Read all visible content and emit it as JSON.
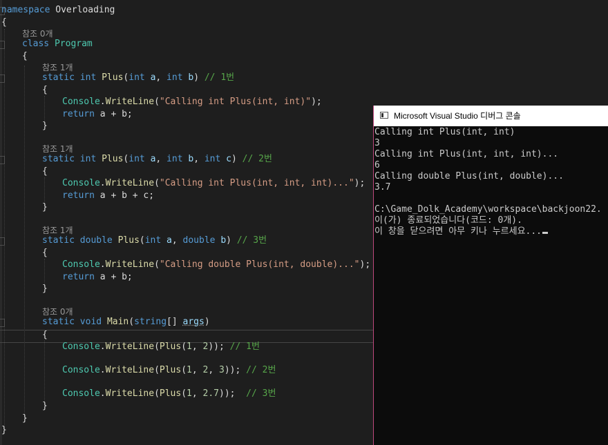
{
  "editor": {
    "lines": {
      "l1": {
        "ns_kw": "namespace",
        "ns_name": "Overloading"
      },
      "l2": {
        "brace": "{"
      },
      "l3": {
        "lens": "참조 0개"
      },
      "l4": {
        "kw": "class",
        "name": "Program"
      },
      "l5": {
        "brace": "{"
      },
      "l6": {
        "lens": "참조 1개"
      },
      "l7": {
        "static": "static",
        "ret": "int",
        "method": "Plus",
        "open": "(",
        "t1": "int",
        "p1": "a",
        "c1": ",",
        "t2": "int",
        "p2": "b",
        "close": ")",
        "comment": "// 1번"
      },
      "l8": {
        "brace": "{"
      },
      "l9": {
        "cls": "Console",
        "dot": ".",
        "method": "WriteLine",
        "open": "(",
        "str": "\"Calling int Plus(int, int)\"",
        "close": ");"
      },
      "l10": {
        "kw": "return",
        "expr": "a + b;"
      },
      "l11": {
        "brace": "}"
      },
      "l12": {
        "lens": "참조 1개"
      },
      "l13": {
        "static": "static",
        "ret": "int",
        "method": "Plus",
        "open": "(",
        "t1": "int",
        "p1": "a",
        "c1": ",",
        "t2": "int",
        "p2": "b",
        "c2": ",",
        "t3": "int",
        "p3": "c",
        "close": ")",
        "comment": "// 2번"
      },
      "l14": {
        "brace": "{"
      },
      "l15": {
        "cls": "Console",
        "dot": ".",
        "method": "WriteLine",
        "open": "(",
        "str": "\"Calling int Plus(int, int, int)...\"",
        "close": ");"
      },
      "l16": {
        "kw": "return",
        "expr": "a + b + c;"
      },
      "l17": {
        "brace": "}"
      },
      "l18": {
        "lens": "참조 1개"
      },
      "l19": {
        "static": "static",
        "ret": "double",
        "method": "Plus",
        "open": "(",
        "t1": "int",
        "p1": "a",
        "c1": ",",
        "t2": "double",
        "p2": "b",
        "close": ")",
        "comment": "// 3번"
      },
      "l20": {
        "brace": "{"
      },
      "l21": {
        "cls": "Console",
        "dot": ".",
        "method": "WriteLine",
        "open": "(",
        "str": "\"Calling double Plus(int, double)...\"",
        "close": ");"
      },
      "l22": {
        "kw": "return",
        "expr": "a + b;"
      },
      "l23": {
        "brace": "}"
      },
      "l24": {
        "lens": "참조 0개"
      },
      "l25": {
        "static": "static",
        "ret": "void",
        "method": "Main",
        "open": "(",
        "t1": "string",
        "arr": "[]",
        "p1": "args",
        "close": ")"
      },
      "l26": {
        "brace": "{"
      },
      "l27": {
        "cls": "Console",
        "dot": ".",
        "method": "WriteLine",
        "open": "(",
        "inner": "Plus",
        "args_open": "(",
        "n1": "1",
        "sep1": ", ",
        "n2": "2",
        "close": "));",
        "comment": "// 1번"
      },
      "l28": {
        "cls": "Console",
        "dot": ".",
        "method": "WriteLine",
        "open": "(",
        "inner": "Plus",
        "args_open": "(",
        "n1": "1",
        "sep1": ", ",
        "n2": "2",
        "sep2": ", ",
        "n3": "3",
        "close": "));",
        "comment": "// 2번"
      },
      "l29": {
        "cls": "Console",
        "dot": ".",
        "method": "WriteLine",
        "open": "(",
        "inner": "Plus",
        "args_open": "(",
        "n1": "1",
        "sep1": ", ",
        "n2": "2.7",
        "close": "));",
        "comment": "// 3번"
      },
      "l30": {
        "brace": "}"
      },
      "l31": {
        "brace": "}"
      },
      "l32": {
        "brace": "}"
      }
    }
  },
  "console": {
    "title": "Microsoft Visual Studio 디버그 콘솔",
    "output": [
      "Calling int Plus(int, int)",
      "3",
      "Calling int Plus(int, int, int)...",
      "6",
      "Calling double Plus(int, double)...",
      "3.7",
      "",
      "C:\\Game_Dolk_Academy\\workspace\\backjoon22.",
      "이(가) 종료되었습니다(코드: 0개).",
      "이 창을 닫으려면 아무 키나 누르세요..."
    ]
  },
  "colors": {
    "editor_bg": "#1e1e1e",
    "keyword": "#569cd6",
    "type": "#4ec9b0",
    "method": "#dcdcaa",
    "string": "#d69d85",
    "comment": "#57a64a",
    "number": "#b5cea8",
    "console_bg": "#0c0c0c",
    "console_text": "#cccccc"
  }
}
